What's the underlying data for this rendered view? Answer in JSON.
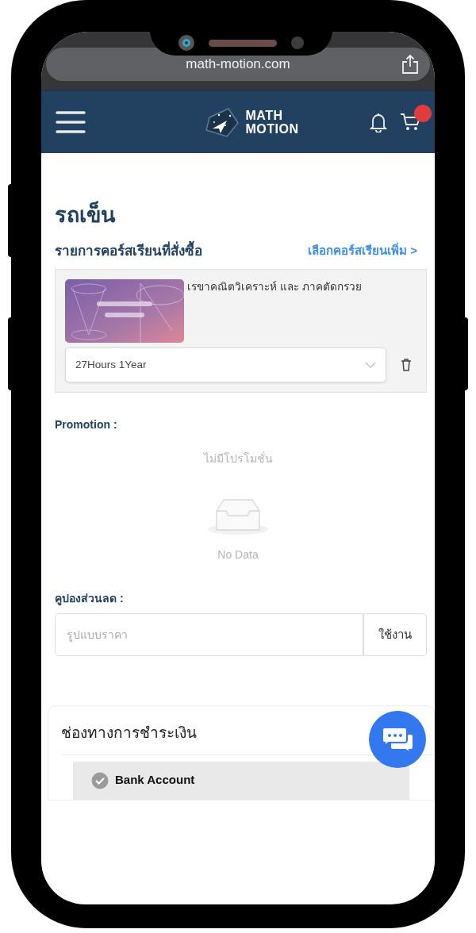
{
  "browser": {
    "url": "math-motion.com"
  },
  "header": {
    "logo_line_1": "MATH",
    "logo_line_2": "MOTION",
    "cart_badge": true
  },
  "page_title": "รถเข็น",
  "cart": {
    "heading": "รายการคอร์สเรียนที่สั่งซื้อ",
    "more_link": "เลือกคอร์สเรียนเพิ่ม >",
    "items": [
      {
        "title": "เรขาคณิตวิเคราะห์ และ ภาคตัดกรวย",
        "package": "27Hours 1Year"
      }
    ]
  },
  "promotion": {
    "label": "Promotion :",
    "message": "ไม่มีโปรโมชั่น",
    "empty_text": "No Data"
  },
  "coupon": {
    "label": "คูปองส่วนลด :",
    "placeholder": "รูปแบบราคา",
    "button": "ใช้งาน"
  },
  "payment": {
    "heading": "ช่องทางการชำระเงิน",
    "methods": [
      {
        "label": "Bank Account",
        "checked": true
      }
    ]
  }
}
